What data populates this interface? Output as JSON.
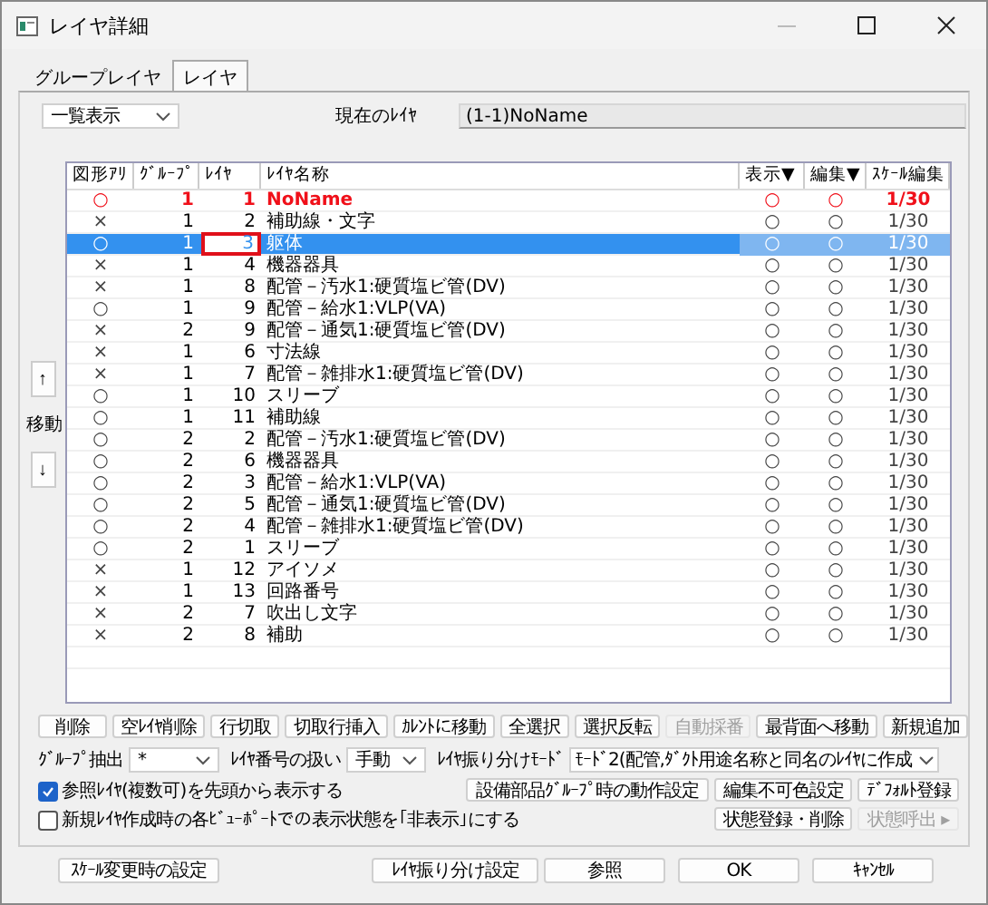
{
  "window": {
    "title": "レイヤ詳細"
  },
  "tabs": [
    {
      "label": "グループレイヤ",
      "selected": false
    },
    {
      "label": "レイヤ",
      "selected": true
    }
  ],
  "view_select": {
    "value": "一覧表示"
  },
  "current_layer": {
    "label": "現在のﾚｲﾔ",
    "value": "(1-1)NoName"
  },
  "move": {
    "up": "↑",
    "label": "移動",
    "down": "↓"
  },
  "table": {
    "columns": [
      "図形ｱﾘ",
      "ｸﾞﾙｰﾌﾟ",
      "ﾚｲﾔ",
      "ﾚｲﾔ名称",
      "表示▼",
      "編集▼",
      "ｽｹｰﾙ編集"
    ],
    "rows": [
      {
        "figure": "○",
        "group": "1",
        "layer": "1",
        "name": "NoName",
        "display": "○",
        "edit": "○",
        "scale": "1/30",
        "current": true,
        "selected": false,
        "editing": false
      },
      {
        "figure": "×",
        "group": "1",
        "layer": "2",
        "name": "補助線・文字",
        "display": "○",
        "edit": "○",
        "scale": "1/30",
        "current": false,
        "selected": false,
        "editing": false
      },
      {
        "figure": "○",
        "group": "1",
        "layer": "3",
        "name": "躯体",
        "display": "○",
        "edit": "○",
        "scale": "1/30",
        "current": false,
        "selected": true,
        "editing": true
      },
      {
        "figure": "×",
        "group": "1",
        "layer": "4",
        "name": "機器器具",
        "display": "○",
        "edit": "○",
        "scale": "1/30",
        "current": false,
        "selected": false,
        "editing": false
      },
      {
        "figure": "×",
        "group": "1",
        "layer": "8",
        "name": "配管－汚水1:硬質塩ビ管(DV)",
        "display": "○",
        "edit": "○",
        "scale": "1/30",
        "current": false,
        "selected": false,
        "editing": false
      },
      {
        "figure": "○",
        "group": "1",
        "layer": "9",
        "name": "配管－給水1:VLP(VA)",
        "display": "○",
        "edit": "○",
        "scale": "1/30",
        "current": false,
        "selected": false,
        "editing": false
      },
      {
        "figure": "×",
        "group": "2",
        "layer": "9",
        "name": "配管－通気1:硬質塩ビ管(DV)",
        "display": "○",
        "edit": "○",
        "scale": "1/30",
        "current": false,
        "selected": false,
        "editing": false
      },
      {
        "figure": "×",
        "group": "1",
        "layer": "6",
        "name": "寸法線",
        "display": "○",
        "edit": "○",
        "scale": "1/30",
        "current": false,
        "selected": false,
        "editing": false
      },
      {
        "figure": "×",
        "group": "1",
        "layer": "7",
        "name": "配管－雑排水1:硬質塩ビ管(DV)",
        "display": "○",
        "edit": "○",
        "scale": "1/30",
        "current": false,
        "selected": false,
        "editing": false
      },
      {
        "figure": "○",
        "group": "1",
        "layer": "10",
        "name": "スリーブ",
        "display": "○",
        "edit": "○",
        "scale": "1/30",
        "current": false,
        "selected": false,
        "editing": false
      },
      {
        "figure": "○",
        "group": "1",
        "layer": "11",
        "name": "補助線",
        "display": "○",
        "edit": "○",
        "scale": "1/30",
        "current": false,
        "selected": false,
        "editing": false
      },
      {
        "figure": "○",
        "group": "2",
        "layer": "2",
        "name": "配管－汚水1:硬質塩ビ管(DV)",
        "display": "○",
        "edit": "○",
        "scale": "1/30",
        "current": false,
        "selected": false,
        "editing": false
      },
      {
        "figure": "○",
        "group": "2",
        "layer": "6",
        "name": "機器器具",
        "display": "○",
        "edit": "○",
        "scale": "1/30",
        "current": false,
        "selected": false,
        "editing": false
      },
      {
        "figure": "○",
        "group": "2",
        "layer": "3",
        "name": "配管－給水1:VLP(VA)",
        "display": "○",
        "edit": "○",
        "scale": "1/30",
        "current": false,
        "selected": false,
        "editing": false
      },
      {
        "figure": "○",
        "group": "2",
        "layer": "5",
        "name": "配管－通気1:硬質塩ビ管(DV)",
        "display": "○",
        "edit": "○",
        "scale": "1/30",
        "current": false,
        "selected": false,
        "editing": false
      },
      {
        "figure": "○",
        "group": "2",
        "layer": "4",
        "name": "配管－雑排水1:硬質塩ビ管(DV)",
        "display": "○",
        "edit": "○",
        "scale": "1/30",
        "current": false,
        "selected": false,
        "editing": false
      },
      {
        "figure": "○",
        "group": "2",
        "layer": "1",
        "name": "スリーブ",
        "display": "○",
        "edit": "○",
        "scale": "1/30",
        "current": false,
        "selected": false,
        "editing": false
      },
      {
        "figure": "×",
        "group": "1",
        "layer": "12",
        "name": "アイソメ",
        "display": "○",
        "edit": "○",
        "scale": "1/30",
        "current": false,
        "selected": false,
        "editing": false
      },
      {
        "figure": "×",
        "group": "1",
        "layer": "13",
        "name": "回路番号",
        "display": "○",
        "edit": "○",
        "scale": "1/30",
        "current": false,
        "selected": false,
        "editing": false
      },
      {
        "figure": "×",
        "group": "2",
        "layer": "7",
        "name": "吹出し文字",
        "display": "○",
        "edit": "○",
        "scale": "1/30",
        "current": false,
        "selected": false,
        "editing": false
      },
      {
        "figure": "×",
        "group": "2",
        "layer": "8",
        "name": "補助",
        "display": "○",
        "edit": "○",
        "scale": "1/30",
        "current": false,
        "selected": false,
        "editing": false
      }
    ]
  },
  "action_buttons": [
    {
      "label": "削除",
      "disabled": false
    },
    {
      "label": "空ﾚｲﾔ削除",
      "disabled": false
    },
    {
      "label": "行切取",
      "disabled": false
    },
    {
      "label": "切取行挿入",
      "disabled": false
    },
    {
      "label": "ｶﾚﾝﾄに移動",
      "disabled": false
    },
    {
      "label": "全選択",
      "disabled": false
    },
    {
      "label": "選択反転",
      "disabled": false
    },
    {
      "label": "自動採番",
      "disabled": true
    },
    {
      "label": "最背面へ移動",
      "disabled": false
    },
    {
      "label": "新規追加",
      "disabled": false
    }
  ],
  "filters": [
    {
      "label": "ｸﾞﾙｰﾌﾟ抽出",
      "value": "*"
    },
    {
      "label": "ﾚｲﾔ番号の扱い",
      "value": "手動"
    },
    {
      "label": "ﾚｲﾔ振り分けﾓｰﾄﾞ",
      "value": "ﾓｰﾄﾞ2(配管,ﾀﾞｸﾄ用途名称と同名のﾚｲﾔに作成"
    }
  ],
  "options": [
    {
      "label": "参照ﾚｲﾔ(複数可)を先頭から表示する",
      "checked": true
    },
    {
      "label": "新規ﾚｲﾔ作成時の各ﾋﾞｭｰﾎﾟｰﾄでの表示状態を｢非表示｣にする",
      "checked": false
    }
  ],
  "setting_buttons": [
    {
      "label": "設備部品ｸﾞﾙｰﾌﾟ時の動作設定",
      "disabled": false
    },
    {
      "label": "編集不可色設定",
      "disabled": false
    },
    {
      "label": "ﾃﾞﾌｫﾙﾄ登録",
      "disabled": false
    },
    {
      "label": "状態登録・削除",
      "disabled": false
    },
    {
      "label": "状態呼出 ▸",
      "disabled": true
    }
  ],
  "footer_buttons": [
    "ｽｹｰﾙ変更時の設定",
    "ﾚｲﾔ振り分け設定",
    "参照",
    "OK",
    "ｷｬﾝｾﾙ"
  ]
}
